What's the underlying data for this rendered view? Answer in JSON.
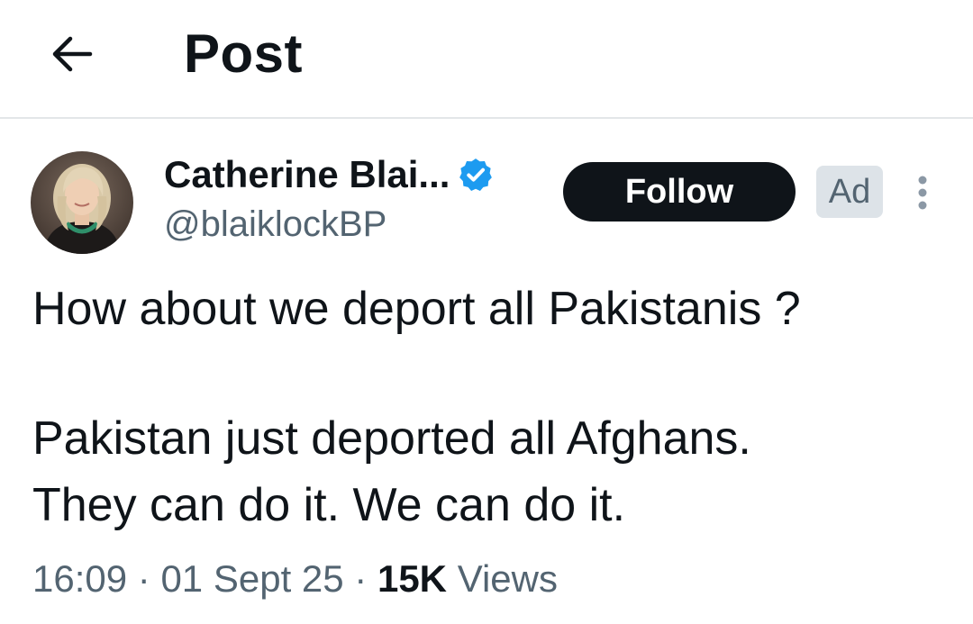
{
  "header": {
    "back_icon": "arrow-left-icon",
    "title": "Post"
  },
  "post": {
    "author": {
      "display_name": "Catherine Blai...",
      "handle": "@blaiklockBP",
      "verified": true,
      "verified_icon": "verified-badge-icon",
      "verified_color": "#1d9bf0"
    },
    "follow_label": "Follow",
    "ad_label": "Ad",
    "more_icon": "more-vertical-icon",
    "text_lines": [
      "How about we deport all Pakistanis ?",
      "",
      "Pakistan just deported all Afghans.",
      "They can do it. We can do it."
    ],
    "meta": {
      "time": "16:09",
      "separator": "·",
      "date": "01 Sept 25",
      "views_count": "15K",
      "views_label": "Views"
    }
  },
  "colors": {
    "text_primary": "#0f1419",
    "text_secondary": "#536471",
    "follow_bg": "#0f1419",
    "ad_bg": "#dde3e8",
    "divider": "#e3e6e8"
  }
}
